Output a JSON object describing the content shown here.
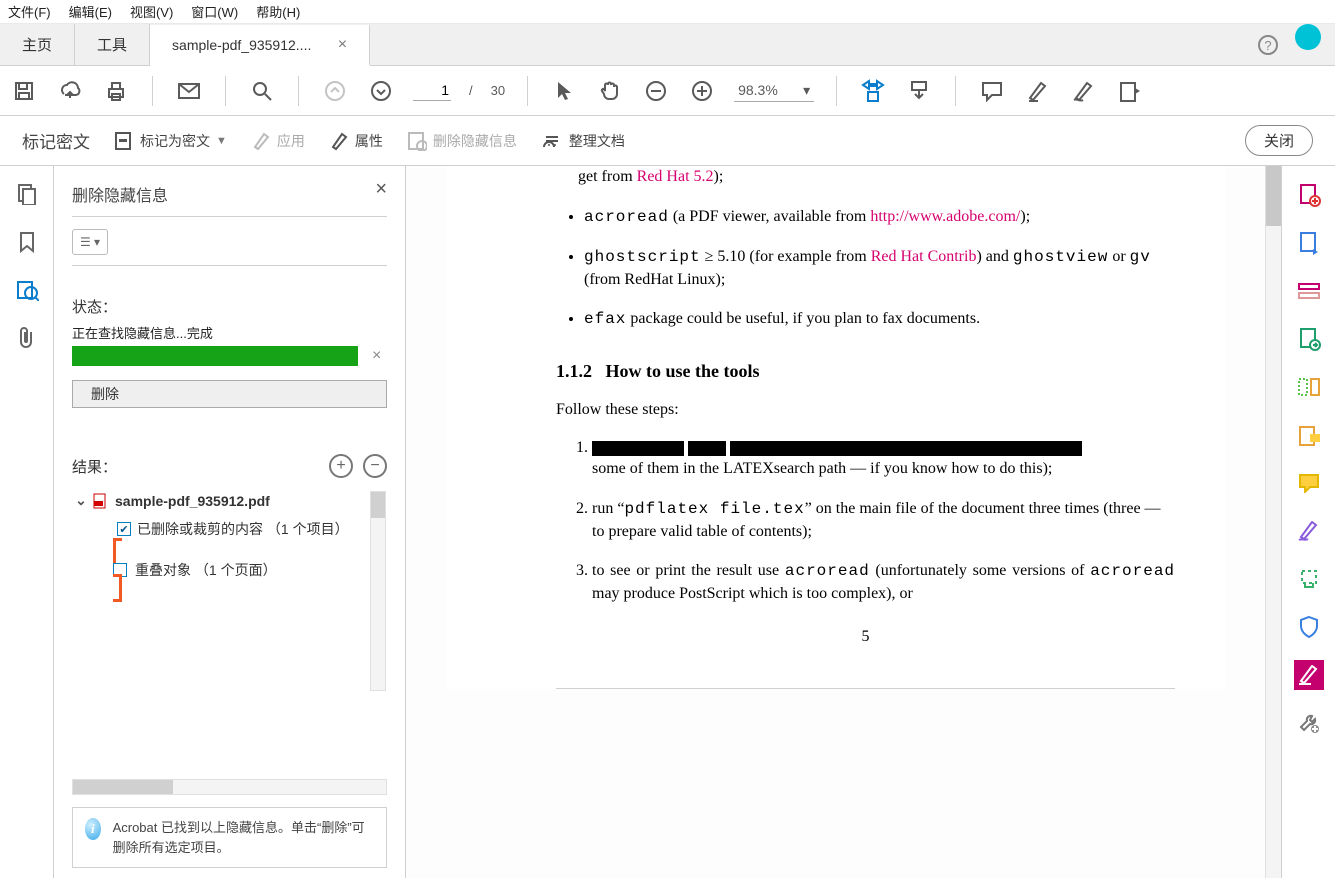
{
  "menubar": {
    "file": "文件(F)",
    "edit": "编辑(E)",
    "view": "视图(V)",
    "window": "窗口(W)",
    "help": "帮助(H)"
  },
  "tabs": {
    "home": "主页",
    "tools": "工具",
    "doc": "sample-pdf_935912...."
  },
  "toolbar": {
    "page_current": "1",
    "page_total": "30",
    "zoom": "98.3%"
  },
  "redactbar": {
    "title": "标记密文",
    "mark": "标记为密文",
    "apply": "应用",
    "properties": "属性",
    "remove_hidden": "删除隐藏信息",
    "organize": "整理文档",
    "close": "关闭"
  },
  "sidepanel": {
    "title": "删除隐藏信息",
    "status_label": "状态：",
    "status_text": "正在查找隐藏信息...完成",
    "delete_btn": "删除",
    "results_label": "结果：",
    "file_name": "sample-pdf_935912.pdf",
    "result_deleted": "已删除或裁剪的内容  （1 个项目）",
    "result_overlap": "重叠对象  （1 个页面）",
    "info_text": "Acrobat 已找到以上隐藏信息。单击“删除”可删除所有选定项目。"
  },
  "doc": {
    "b0_a": "get from ",
    "b0_link": "Red Hat 5.2",
    "b0_c": ");",
    "b1_code": "acroread",
    "b1_a": " (a PDF viewer, available from ",
    "b1_link": "http://www.adobe.com/",
    "b1_c": ");",
    "b2_code": "ghostscript",
    "b2_ge": " ≥ 5.10",
    "b2_a": " (for example from ",
    "b2_link": "Red Hat Contrib",
    "b2_b": ") and ",
    "b2_code2": "ghostview",
    "b2_c": " or ",
    "b2_code3": "gv",
    "b2_d": " (from RedHat Linux);",
    "b3_code": "efax",
    "b3_a": " package could be useful, if you plan to fax documents.",
    "sec_num": "1.1.2",
    "sec_title": "How to use the tools",
    "follow": "Follow these steps:",
    "li1_b": "some of them in the LATEXsearch path — if you know how to do this);",
    "li2_a": "run “",
    "li2_code": "pdflatex file.tex",
    "li2_b": "” on the main file of the document three times (three — to prepare valid table of contents);",
    "li3_a": "to see or print the result use ",
    "li3_code1": "acroread",
    "li3_b": " (unfortunately some versions of ",
    "li3_code2": "acroread",
    "li3_c": " may produce PostScript which is too complex), or",
    "pagenum": "5"
  }
}
